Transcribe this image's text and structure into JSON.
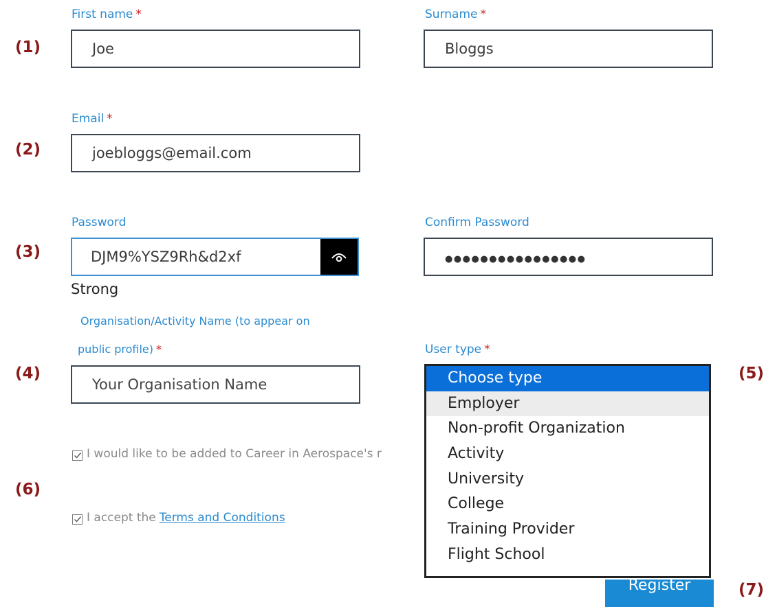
{
  "markers": [
    "(1)",
    "(2)",
    "(3)",
    "(4)",
    "(5)",
    "(6)",
    "(7)"
  ],
  "first_name": {
    "label": "First name",
    "required": "*",
    "value": "Joe"
  },
  "surname": {
    "label": "Surname",
    "required": "*",
    "value": "Bloggs"
  },
  "email": {
    "label": "Email",
    "required": "*",
    "value": "joebloggs@email.com"
  },
  "password": {
    "label": "Password",
    "value": "DJM9%YSZ9Rh&d2xf",
    "toggle_icon": "eye-icon",
    "strength": "Strong"
  },
  "confirm_password": {
    "label": "Confirm Password",
    "value": "●●●●●●●●●●●●●●●●"
  },
  "organisation": {
    "label_line1": "Organisation/Activity Name (to appear on",
    "label_line2": "public profile)",
    "required": "*",
    "placeholder": "Your Organisation Name"
  },
  "user_type": {
    "label": "User type",
    "required": "*",
    "options": [
      "Choose type",
      "Employer",
      "Non-profit Organization",
      "Activity",
      "University",
      "College",
      "Training Provider",
      "Flight School"
    ],
    "selected": "Choose type",
    "hovered": "Employer"
  },
  "newsletter_checkbox": {
    "label": "I would like to be added to Career in Aerospace's r",
    "checked": true
  },
  "terms_checkbox": {
    "label_prefix": "I accept the",
    "link": "Terms and Conditions",
    "checked": true
  },
  "register_button": {
    "label": "Register"
  },
  "colors": {
    "label_blue": "#2a8bd0",
    "required_red": "#cc2222",
    "marker": "#8b1a1a",
    "selected_option": "#0a6fd8",
    "button": "#1a8ad4"
  }
}
